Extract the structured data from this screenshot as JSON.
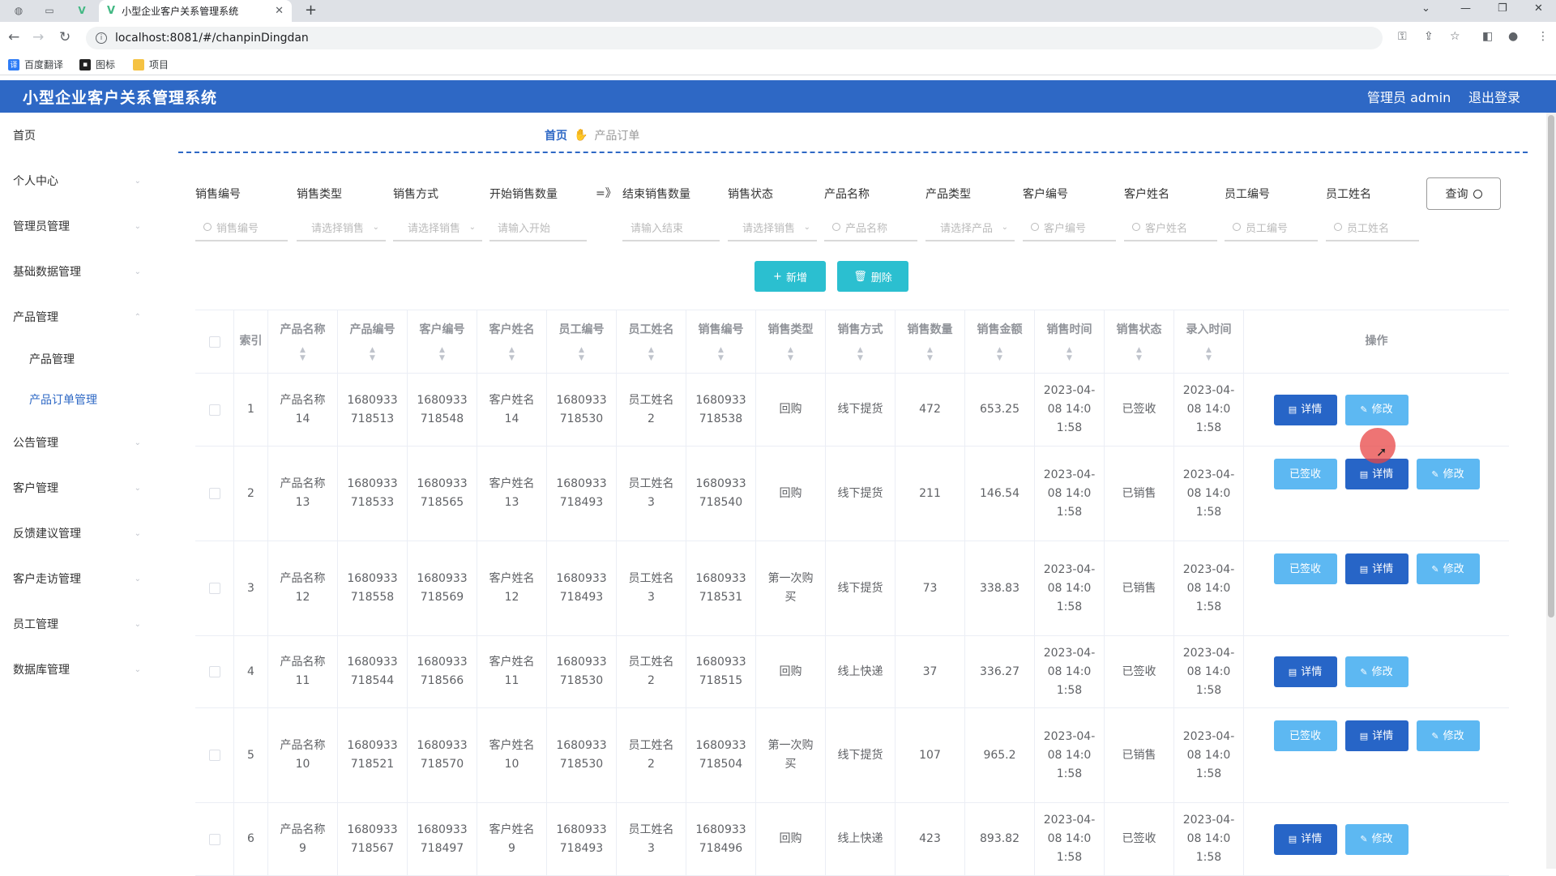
{
  "browser": {
    "tab_title": "小型企业客户关系管理系统",
    "url": "localhost:8081/#/chanpinDingdan",
    "bookmarks": [
      "百度翻译",
      "图标",
      "项目"
    ]
  },
  "app": {
    "title": "小型企业客户关系管理系统",
    "user_label": "管理员 admin",
    "logout_label": "退出登录"
  },
  "sidebar": {
    "items": [
      {
        "label": "首页"
      },
      {
        "label": "个人中心"
      },
      {
        "label": "管理员管理"
      },
      {
        "label": "基础数据管理"
      },
      {
        "label": "产品管理"
      },
      {
        "label": "产品管理"
      },
      {
        "label": "产品订单管理"
      },
      {
        "label": "公告管理"
      },
      {
        "label": "客户管理"
      },
      {
        "label": "反馈建议管理"
      },
      {
        "label": "客户走访管理"
      },
      {
        "label": "员工管理"
      },
      {
        "label": "数据库管理"
      }
    ]
  },
  "breadcrumb": {
    "home": "首页",
    "current": "产品订单"
  },
  "search": {
    "fields": [
      {
        "label": "销售编号",
        "placeholder": "销售编号"
      },
      {
        "label": "销售类型",
        "placeholder": "请选择销售"
      },
      {
        "label": "销售方式",
        "placeholder": "请选择销售"
      },
      {
        "label": "开始销售数量",
        "placeholder": "请输入开始"
      },
      {
        "label": "结束销售数量",
        "placeholder": "请输入结束"
      },
      {
        "label": "销售状态",
        "placeholder": "请选择销售"
      },
      {
        "label": "产品名称",
        "placeholder": "产品名称"
      },
      {
        "label": "产品类型",
        "placeholder": "请选择产品"
      },
      {
        "label": "客户编号",
        "placeholder": "客户编号"
      },
      {
        "label": "客户姓名",
        "placeholder": "客户姓名"
      },
      {
        "label": "员工编号",
        "placeholder": "员工编号"
      },
      {
        "label": "员工姓名",
        "placeholder": "员工姓名"
      }
    ],
    "range_symbol": "=》",
    "query_label": "查询"
  },
  "actions": {
    "add_label": "新增",
    "delete_label": "删除"
  },
  "table": {
    "headers": [
      "索引",
      "产品名称",
      "产品编号",
      "客户编号",
      "客户姓名",
      "员工编号",
      "员工姓名",
      "销售编号",
      "销售类型",
      "销售方式",
      "销售数量",
      "销售金额",
      "销售时间",
      "销售状态",
      "录入时间",
      "操作"
    ],
    "op_labels": {
      "detail": "详情",
      "edit": "修改",
      "delete": "删除",
      "sign": "已签收"
    },
    "rows": [
      {
        "idx": "1",
        "pname": "产品名称14",
        "pno": "1680933718513",
        "cno": "1680933718548",
        "cname": "客户姓名14",
        "eno": "1680933718530",
        "ename": "员工姓名2",
        "sno": "1680933718538",
        "stype": "回购",
        "smethod": "线下提货",
        "qty": "472",
        "amount": "653.25",
        "stime": "2023-04-08 14:01:58",
        "status": "已签收",
        "itime": "2023-04-08 14:01:58"
      },
      {
        "idx": "2",
        "pname": "产品名称13",
        "pno": "1680933718533",
        "cno": "1680933718565",
        "cname": "客户姓名13",
        "eno": "1680933718493",
        "ename": "员工姓名3",
        "sno": "1680933718540",
        "stype": "回购",
        "smethod": "线下提货",
        "qty": "211",
        "amount": "146.54",
        "stime": "2023-04-08 14:01:58",
        "status": "已销售",
        "itime": "2023-04-08 14:01:58"
      },
      {
        "idx": "3",
        "pname": "产品名称12",
        "pno": "1680933718558",
        "cno": "1680933718569",
        "cname": "客户姓名12",
        "eno": "1680933718493",
        "ename": "员工姓名3",
        "sno": "1680933718531",
        "stype": "第一次购买",
        "smethod": "线下提货",
        "qty": "73",
        "amount": "338.83",
        "stime": "2023-04-08 14:01:58",
        "status": "已销售",
        "itime": "2023-04-08 14:01:58"
      },
      {
        "idx": "4",
        "pname": "产品名称11",
        "pno": "1680933718544",
        "cno": "1680933718566",
        "cname": "客户姓名11",
        "eno": "1680933718530",
        "ename": "员工姓名2",
        "sno": "1680933718515",
        "stype": "回购",
        "smethod": "线上快递",
        "qty": "37",
        "amount": "336.27",
        "stime": "2023-04-08 14:01:58",
        "status": "已签收",
        "itime": "2023-04-08 14:01:58"
      },
      {
        "idx": "5",
        "pname": "产品名称10",
        "pno": "1680933718521",
        "cno": "1680933718570",
        "cname": "客户姓名10",
        "eno": "1680933718530",
        "ename": "员工姓名2",
        "sno": "1680933718504",
        "stype": "第一次购买",
        "smethod": "线下提货",
        "qty": "107",
        "amount": "965.2",
        "stime": "2023-04-08 14:01:58",
        "status": "已销售",
        "itime": "2023-04-08 14:01:58"
      },
      {
        "idx": "6",
        "pname": "产品名称9",
        "pno": "1680933718567",
        "cno": "1680933718497",
        "cname": "客户姓名9",
        "eno": "1680933718493",
        "ename": "员工姓名3",
        "sno": "1680933718496",
        "stype": "回购",
        "smethod": "线上快递",
        "qty": "423",
        "amount": "893.82",
        "stime": "2023-04-08 14:01:58",
        "status": "已签收",
        "itime": "2023-04-08 14:01:58"
      }
    ]
  }
}
